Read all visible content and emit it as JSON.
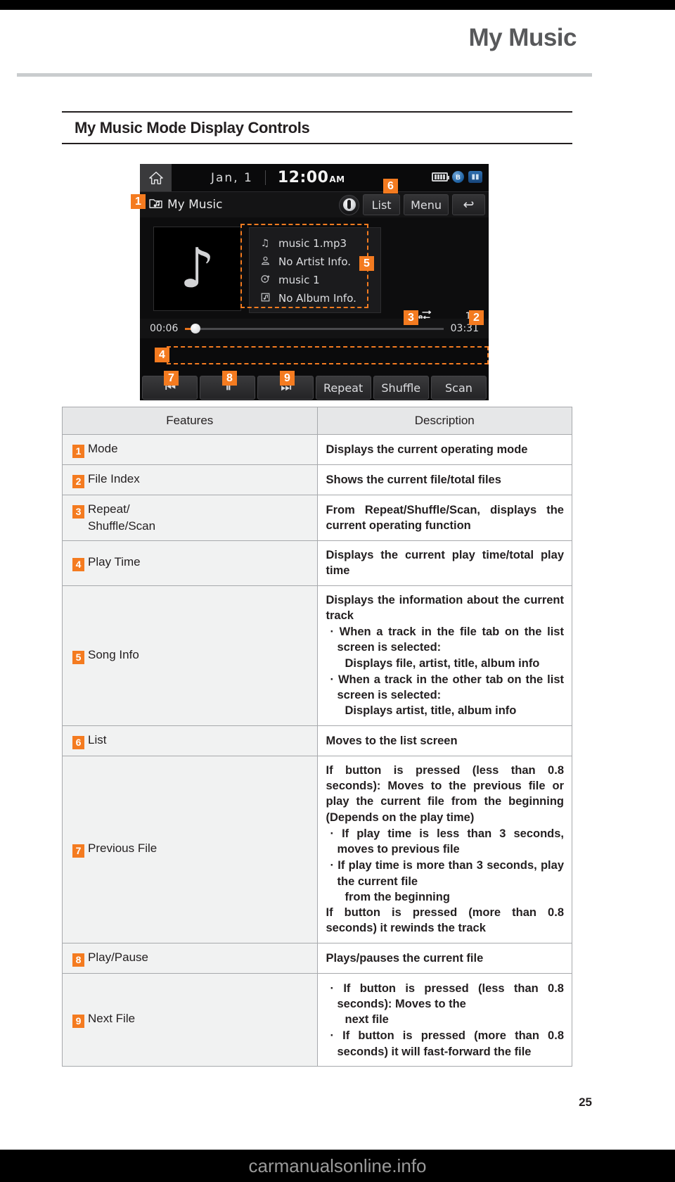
{
  "chapter": {
    "title": "My Music"
  },
  "section": {
    "title": "My Music Mode Display Controls"
  },
  "device": {
    "status_bar": {
      "home_icon": "home-icon",
      "date": "Jan,  1",
      "time": "12:00",
      "ampm": "AM",
      "icons": [
        "battery-icon",
        "bluetooth-icon",
        "phone-signal-icon"
      ]
    },
    "mode_bar": {
      "mode_icon": "folder-music-icon",
      "mode_label": "My Music",
      "voice_button": "voice-recognition-icon",
      "list_label": "List",
      "menu_label": "Menu",
      "back_label": "↩"
    },
    "album_art_icon": "music-note-icon",
    "song_info": [
      {
        "icon": "music-note-icon",
        "text": "music 1.mp3"
      },
      {
        "icon": "artist-icon",
        "text": "No Artist Info."
      },
      {
        "icon": "genre-icon",
        "text": "music 1"
      },
      {
        "icon": "album-icon",
        "text": "No Album Info."
      }
    ],
    "meta": {
      "repeat_icon": "repeat-one-icon",
      "file_index": "1/5"
    },
    "progress": {
      "current_time": "00:06",
      "total_time": "03:31",
      "percent": 4
    },
    "transport": [
      {
        "name": "previous-file-button",
        "label": "⏮"
      },
      {
        "name": "play-pause-button",
        "label": "⏸"
      },
      {
        "name": "next-file-button",
        "label": "⏭"
      },
      {
        "name": "repeat-button",
        "label": "Repeat"
      },
      {
        "name": "shuffle-button",
        "label": "Shuffle"
      },
      {
        "name": "scan-button",
        "label": "Scan"
      }
    ],
    "callouts": [
      "1",
      "2",
      "3",
      "4",
      "5",
      "6",
      "7",
      "8",
      "9"
    ]
  },
  "table": {
    "headers": {
      "features": "Features",
      "description": "Description"
    },
    "rows": [
      {
        "num": "1",
        "feature": "Mode",
        "desc_main": "Displays the current operating mode",
        "desc_subs": []
      },
      {
        "num": "2",
        "feature": "File Index",
        "desc_main": "Shows the current file/total files",
        "desc_subs": []
      },
      {
        "num": "3",
        "feature": "Repeat/\nShuffle/Scan",
        "feature_line1": "Repeat/",
        "feature_line2": "Shuffle/Scan",
        "desc_main": "From Repeat/Shuffle/Scan, displays the current operating function",
        "desc_subs": []
      },
      {
        "num": "4",
        "feature": "Play Time",
        "desc_main": "Displays the current play time/total play time",
        "desc_subs": []
      },
      {
        "num": "5",
        "feature": "Song Info",
        "desc_main": "Displays the information about the current track",
        "desc_subs": [
          {
            "lead": "When a track in the file tab on the list screen is selected:",
            "cont": "Displays file, artist, title, album info"
          },
          {
            "lead": "When a track in the other tab on the list screen is selected:",
            "cont": "Displays artist, title, album info"
          }
        ]
      },
      {
        "num": "6",
        "feature": "List",
        "desc_main": "Moves to the list screen",
        "desc_subs": []
      },
      {
        "num": "7",
        "feature": "Previous File",
        "desc_main": "If button is pressed (less than 0.8 seconds): Moves to the previous file or play the current file from the beginning (Depends on the play time)",
        "desc_subs": [
          {
            "lead": "If play time is less than 3 seconds, moves to previous file",
            "cont": ""
          },
          {
            "lead": "If play time is more than 3 seconds, play the current file",
            "cont": "from the beginning"
          }
        ],
        "desc_tail": "If button is pressed (more than 0.8 seconds) it rewinds the track"
      },
      {
        "num": "8",
        "feature": "Play/Pause",
        "desc_main": "Plays/pauses the current file",
        "desc_subs": []
      },
      {
        "num": "9",
        "feature": "Next File",
        "desc_main": "",
        "desc_subs": [
          {
            "lead": "If button is pressed (less than 0.8 seconds): Moves to the",
            "cont": "next file"
          },
          {
            "lead": "If button is pressed (more than 0.8 seconds) it will fast-forward the file",
            "cont": ""
          }
        ]
      }
    ]
  },
  "footer": {
    "page_number": "25",
    "watermark": "carmanualsonline.info"
  },
  "colors": {
    "accent": "#f47b20",
    "header_gray": "#58595b",
    "rule": "#c9ccce"
  }
}
